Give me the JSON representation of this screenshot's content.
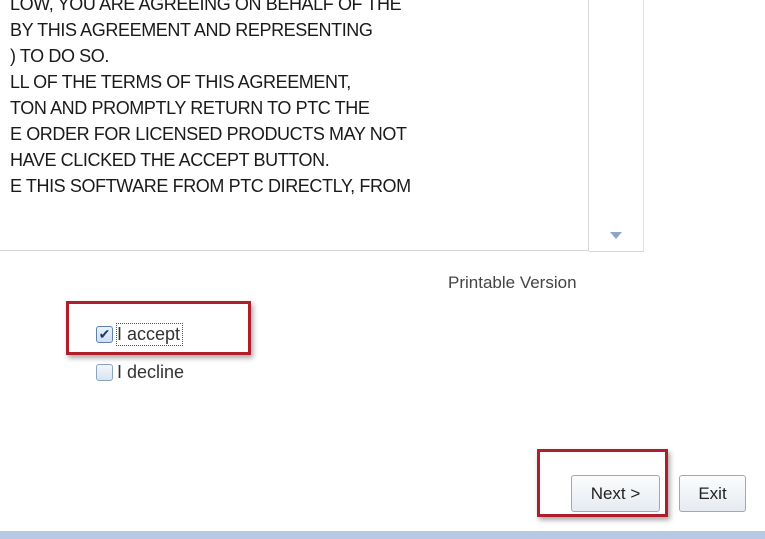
{
  "license": {
    "lines": [
      "LOW, YOU ARE AGREEING ON BEHALF OF THE",
      "BY THIS AGREEMENT AND REPRESENTING",
      ") TO DO SO.",
      "LL OF THE TERMS OF THIS AGREEMENT,",
      "TON AND PROMPTLY RETURN TO PTC THE",
      "E ORDER FOR LICENSED PRODUCTS MAY NOT",
      " HAVE CLICKED THE ACCEPT BUTTON.",
      "E THIS SOFTWARE FROM PTC DIRECTLY, FROM"
    ]
  },
  "printable_version": "Printable Version",
  "options": {
    "accept": {
      "label": "I accept",
      "checked": true
    },
    "decline": {
      "label": "I decline",
      "checked": false
    }
  },
  "buttons": {
    "next": "Next >",
    "exit": "Exit"
  },
  "icons": {
    "scroll": "scroll-down-arrow-icon",
    "check": "checkmark-icon"
  },
  "colors": {
    "highlight": "#b01d2b",
    "bottom_bar": "#b6cbe3"
  }
}
